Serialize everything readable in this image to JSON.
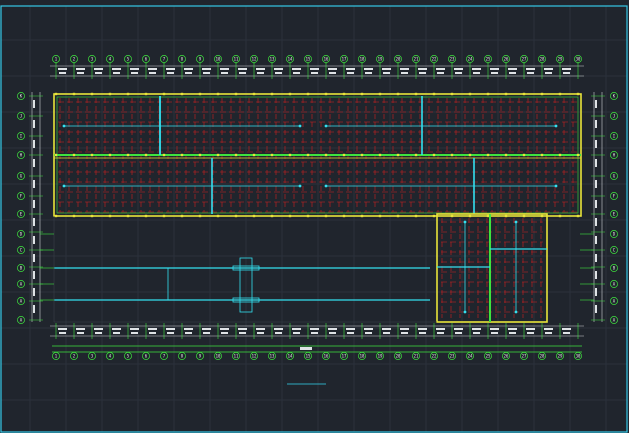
{
  "drawing": {
    "title": "",
    "scale_note": "",
    "colors": {
      "background": "#20252d",
      "frame": "#35c8e6",
      "axis": "#3ee33e",
      "wall": "#e8e43a",
      "beam": "#33e0f0",
      "red_grid": "#d32020",
      "dim_text": "#e6e6e6"
    },
    "top_axis_labels": [
      "1",
      "2",
      "3",
      "4",
      "5",
      "6",
      "7",
      "8",
      "9",
      "10",
      "11",
      "12",
      "13",
      "14",
      "15",
      "16",
      "17",
      "18",
      "19",
      "20",
      "21",
      "22",
      "23",
      "24",
      "25",
      "26",
      "27",
      "28",
      "29",
      "30"
    ],
    "side_axis_labels": [
      "K",
      "J",
      "I",
      "H",
      "G",
      "F",
      "E",
      "D",
      "C",
      "B",
      "A"
    ],
    "vertical_labels": [
      "",
      ""
    ]
  }
}
